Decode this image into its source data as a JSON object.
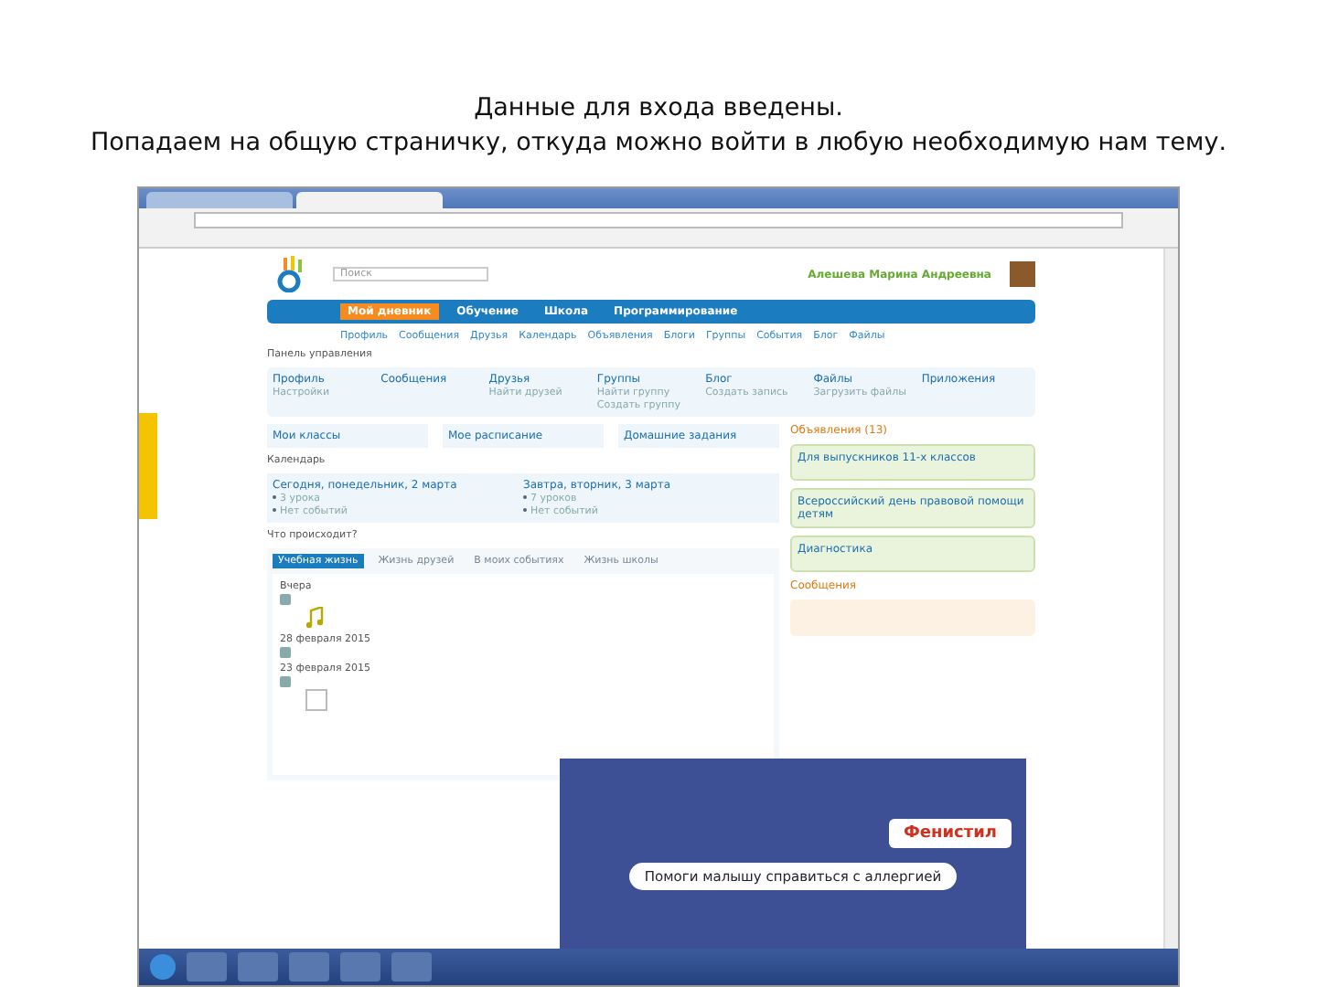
{
  "caption": [
    "Данные для входа введены.",
    "Попадаем на общую страничку, откуда можно войти в любую необходимую нам тему."
  ],
  "browser": {
    "tabs": [
      {
        "selected": false
      },
      {
        "selected": true
      }
    ]
  },
  "site": {
    "search": {
      "placeholder": "Поиск"
    },
    "user_name": "Алешева Марина Андреевна",
    "nav": [
      {
        "label": "Мой дневник",
        "selected": true
      },
      {
        "label": "Обучение",
        "selected": false
      },
      {
        "label": "Школа",
        "selected": false
      },
      {
        "label": "Программирование",
        "selected": false
      }
    ],
    "subnav": [
      "Профиль",
      "Сообщения",
      "Друзья",
      "Календарь",
      "Объявления",
      "Блоги",
      "Группы",
      "События",
      "Блог",
      "Файлы"
    ],
    "panel": {
      "title": "Панель управления",
      "items": [
        {
          "label": "Профиль",
          "links": [
            "Настройки"
          ]
        },
        {
          "label": "Сообщения"
        },
        {
          "label": "Друзья",
          "links": [
            "Найти друзей"
          ]
        },
        {
          "label": "Группы",
          "links": [
            "Найти группу",
            "Создать группу"
          ]
        },
        {
          "label": "Блог",
          "links": [
            "Создать запись"
          ]
        },
        {
          "label": "Файлы",
          "links": [
            "Загрузить файлы"
          ]
        },
        {
          "label": "Приложения"
        }
      ]
    },
    "shortcuts": [
      "Мои классы",
      "Мое расписание",
      "Домашние задания"
    ],
    "calendar": {
      "title": "Календарь",
      "days": [
        {
          "heading": "Сегодня, понедельник, 2 марта",
          "items": [
            "3 урока",
            "Нет событий"
          ]
        },
        {
          "heading": "Завтра, вторник, 3 марта",
          "items": [
            "7 уроков",
            "Нет событий"
          ]
        }
      ]
    },
    "feed": {
      "title": "Что происходит?",
      "tabs": [
        {
          "label": "Учебная жизнь",
          "selected": true
        },
        {
          "label": "Жизнь друзей",
          "selected": false
        },
        {
          "label": "В моих событиях",
          "selected": false
        },
        {
          "label": "Жизнь школы",
          "selected": false
        }
      ],
      "groups": [
        {
          "date": "Вчера",
          "kind": "music"
        },
        {
          "date": "28 февраля 2015",
          "kind": "none"
        },
        {
          "date": "23 февраля 2015",
          "kind": "file"
        }
      ]
    },
    "announcements": {
      "title": "Объявления (13)",
      "items": [
        "Для выпускников 11-х классов",
        "Всероссийский день правовой помощи детям",
        "Диагностика"
      ]
    },
    "messages": {
      "title": "Сообщения"
    }
  },
  "ad": {
    "brand": "Фенистил",
    "slogan": "Помоги малышу справиться с аллергией"
  }
}
